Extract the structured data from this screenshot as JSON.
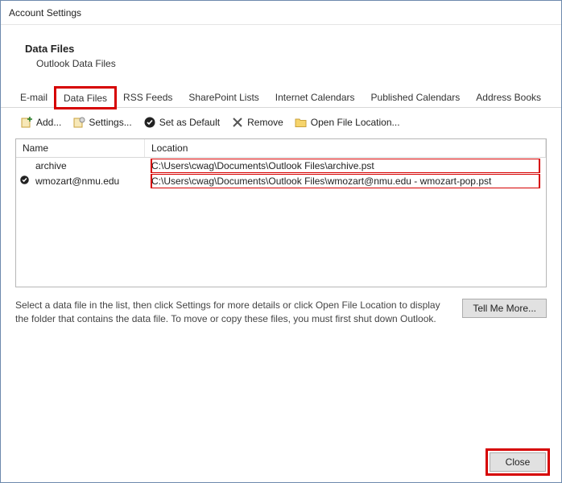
{
  "window": {
    "title": "Account Settings"
  },
  "header": {
    "title": "Data Files",
    "subtitle": "Outlook Data Files"
  },
  "tabs": [
    {
      "label": "E-mail"
    },
    {
      "label": "Data Files",
      "active": true,
      "highlight": true
    },
    {
      "label": "RSS Feeds"
    },
    {
      "label": "SharePoint Lists"
    },
    {
      "label": "Internet Calendars"
    },
    {
      "label": "Published Calendars"
    },
    {
      "label": "Address Books"
    }
  ],
  "toolbar": {
    "add": "Add...",
    "settings": "Settings...",
    "default": "Set as Default",
    "remove": "Remove",
    "open": "Open File Location..."
  },
  "columns": {
    "name": "Name",
    "location": "Location"
  },
  "rows": [
    {
      "default": false,
      "name": "archive",
      "location": "C:\\Users\\cwag\\Documents\\Outlook Files\\archive.pst"
    },
    {
      "default": true,
      "name": "wmozart@nmu.edu",
      "location": "C:\\Users\\cwag\\Documents\\Outlook Files\\wmozart@nmu.edu - wmozart-pop.pst"
    }
  ],
  "help": "Select a data file in the list, then click Settings for more details or click Open File Location to display the folder that contains the data file. To move or copy these files, you must first shut down Outlook.",
  "buttons": {
    "tellme": "Tell Me More...",
    "close": "Close"
  }
}
